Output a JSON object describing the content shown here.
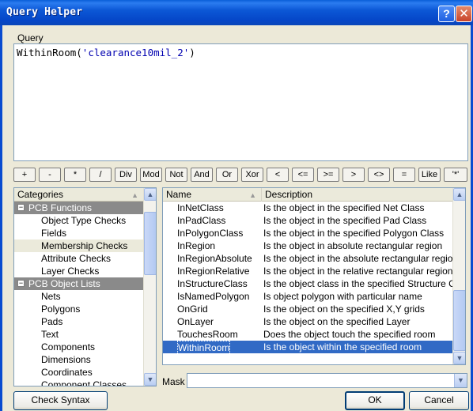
{
  "window": {
    "title": "Query Helper",
    "help": "?",
    "close": "✕"
  },
  "query": {
    "label": "Query",
    "func": "WithinRoom(",
    "arg": "'clearance10mil_2'",
    "close": ")"
  },
  "operators": [
    "+",
    "-",
    "*",
    "/",
    "Div",
    "Mod",
    "Not",
    "And",
    "Or",
    "Xor",
    "<",
    "<=",
    ">=",
    ">",
    "<>",
    "=",
    "Like",
    "'*'"
  ],
  "categories": {
    "header": "Categories",
    "rows": [
      {
        "label": "PCB Functions",
        "type": "group",
        "toggle": "−"
      },
      {
        "label": "Object Type Checks",
        "type": "item"
      },
      {
        "label": "Fields",
        "type": "item"
      },
      {
        "label": "Membership Checks",
        "type": "selected"
      },
      {
        "label": "Attribute Checks",
        "type": "item"
      },
      {
        "label": "Layer Checks",
        "type": "item"
      },
      {
        "label": "PCB Object Lists",
        "type": "group",
        "toggle": "−"
      },
      {
        "label": "Nets",
        "type": "item"
      },
      {
        "label": "Polygons",
        "type": "item"
      },
      {
        "label": "Pads",
        "type": "item"
      },
      {
        "label": "Text",
        "type": "item"
      },
      {
        "label": "Components",
        "type": "item"
      },
      {
        "label": "Dimensions",
        "type": "item"
      },
      {
        "label": "Coordinates",
        "type": "item"
      },
      {
        "label": "Component Classes",
        "type": "item"
      }
    ]
  },
  "functions": {
    "col_name": "Name",
    "col_desc": "Description",
    "rows": [
      {
        "name": "InNetClass",
        "desc": "Is the object in the specified Net Class"
      },
      {
        "name": "InPadClass",
        "desc": "Is the object in the specified Pad Class"
      },
      {
        "name": "InPolygonClass",
        "desc": "Is the object in the specified Polygon Class"
      },
      {
        "name": "InRegion",
        "desc": "Is the object in absolute rectangular region"
      },
      {
        "name": "InRegionAbsolute",
        "desc": "Is the object in the absolute rectangular region"
      },
      {
        "name": "InRegionRelative",
        "desc": "Is the object in the relative rectangular region"
      },
      {
        "name": "InStructureClass",
        "desc": "Is the object class in the specified Structure Class"
      },
      {
        "name": "IsNamedPolygon",
        "desc": "Is object polygon with particular name"
      },
      {
        "name": "OnGrid",
        "desc": "Is the object on the specified X,Y grids"
      },
      {
        "name": "OnLayer",
        "desc": "Is the object on the specified Layer"
      },
      {
        "name": "TouchesRoom",
        "desc": "Does the object touch the specified room"
      },
      {
        "name": "WithinRoom",
        "desc": "Is the object within the specified room",
        "selected": true
      }
    ]
  },
  "mask": {
    "label": "Mask",
    "value": ""
  },
  "buttons": {
    "check_syntax": "Check Syntax",
    "ok": "OK",
    "cancel": "Cancel"
  }
}
